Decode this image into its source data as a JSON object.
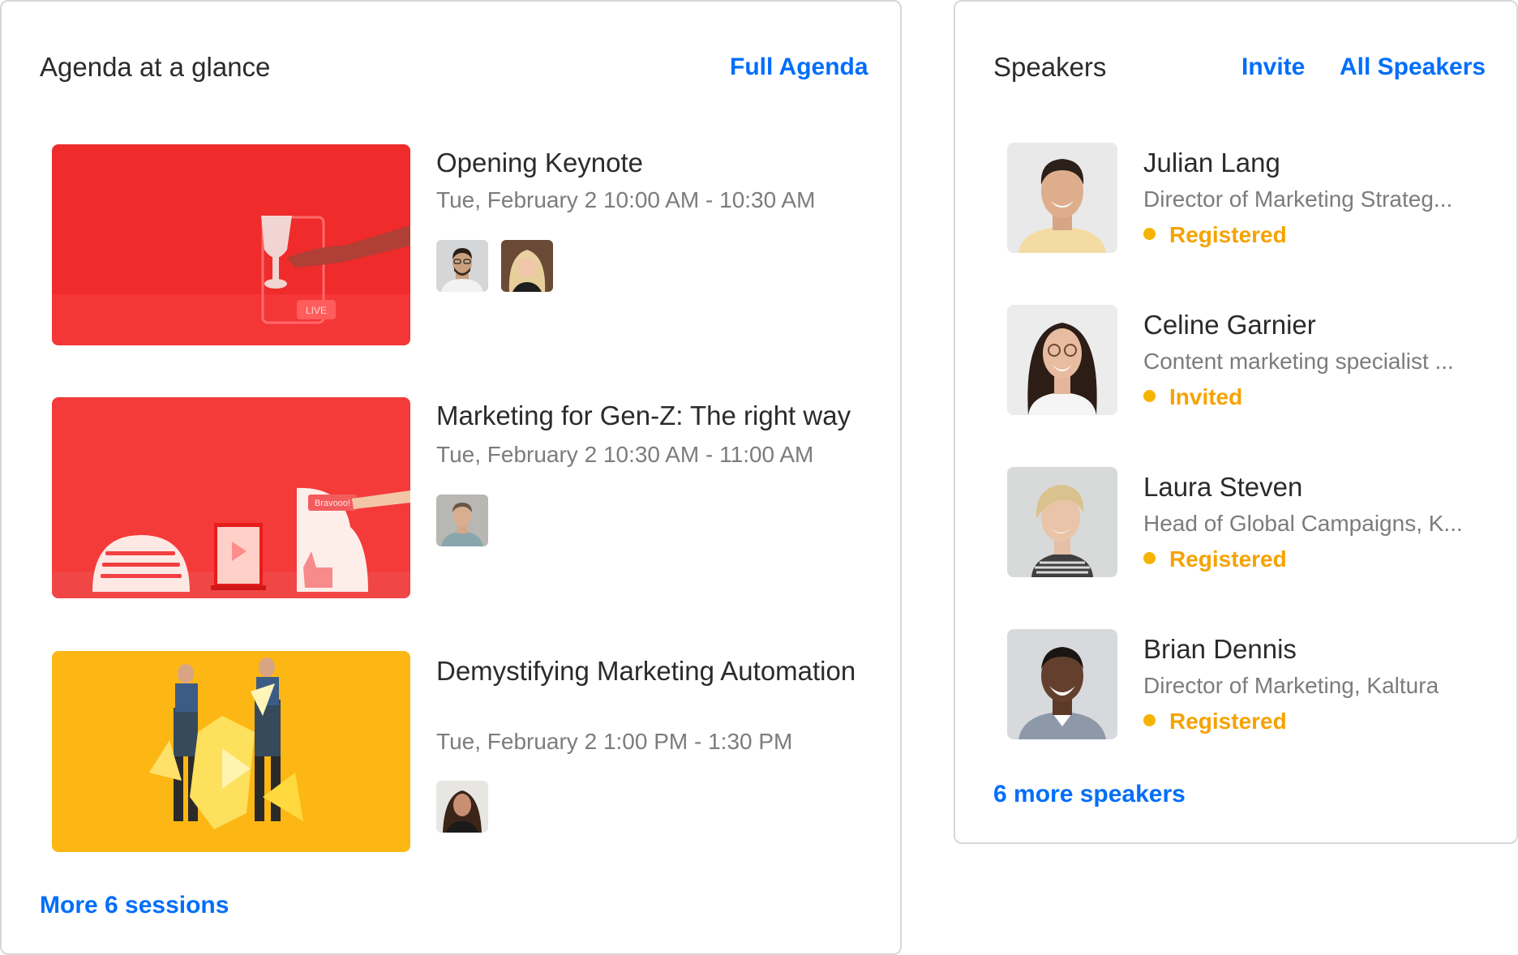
{
  "agenda": {
    "title": "Agenda at a glance",
    "full_agenda_link": "Full Agenda",
    "more_sessions_link": "More 6 sessions",
    "sessions": [
      {
        "title": "Opening Keynote",
        "time": "Tue, February 2  10:00 AM - 10:30 AM",
        "thumbnail_badge": "LIVE",
        "speaker_count": 2
      },
      {
        "title": "Marketing for Gen-Z: The right way",
        "time": "Tue, February 2  10:30 AM - 11:00 AM",
        "thumbnail_badge": "Bravooo!",
        "speaker_count": 1
      },
      {
        "title": "Demystifying Marketing Automation",
        "time": "Tue, February 2  1:00 PM - 1:30 PM",
        "speaker_count": 1
      }
    ]
  },
  "speakers": {
    "title": "Speakers",
    "invite_link": "Invite",
    "all_speakers_link": "All Speakers",
    "more_speakers_link": "6 more speakers",
    "list": [
      {
        "name": "Julian Lang",
        "role": "Director of Marketing Strateg...",
        "status": "Registered"
      },
      {
        "name": "Celine Garnier",
        "role": "Content marketing specialist ...",
        "status": "Invited"
      },
      {
        "name": "Laura Steven",
        "role": "Head of Global Campaigns, K...",
        "status": "Registered"
      },
      {
        "name": "Brian Dennis",
        "role": "Director of Marketing, Kaltura",
        "status": "Registered"
      }
    ]
  },
  "colors": {
    "link": "#006efa",
    "status": "#f5a300",
    "border": "#d7d7d7",
    "text": "#2b2b2b",
    "muted": "#7c7c7c"
  }
}
